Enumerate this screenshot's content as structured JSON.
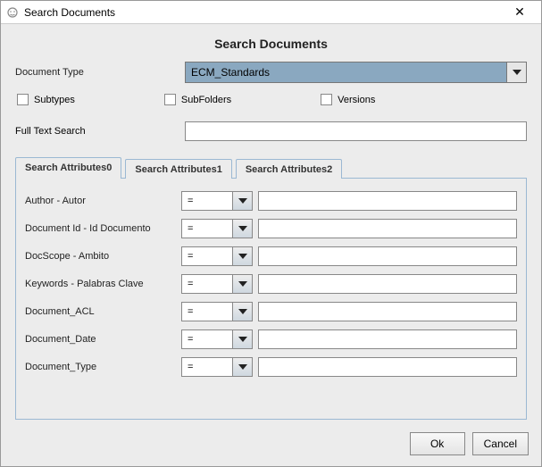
{
  "window": {
    "title": "Search Documents",
    "heading": "Search Documents"
  },
  "doctype": {
    "label": "Document Type",
    "value": "ECM_Standards"
  },
  "checks": {
    "subtypes": "Subtypes",
    "subfolders": "SubFolders",
    "versions": "Versions"
  },
  "fulltext": {
    "label": "Full Text Search",
    "value": ""
  },
  "tabs": {
    "t0": "Search Attributes0",
    "t1": "Search Attributes1",
    "t2": "Search Attributes2"
  },
  "attrs": [
    {
      "label": "Author - Autor",
      "op": "="
    },
    {
      "label": "Document Id - Id Documento",
      "op": "="
    },
    {
      "label": "DocScope - Ambito",
      "op": "="
    },
    {
      "label": "Keywords - Palabras Clave",
      "op": "="
    },
    {
      "label": "Document_ACL",
      "op": "="
    },
    {
      "label": "Document_Date",
      "op": "="
    },
    {
      "label": "Document_Type",
      "op": "="
    }
  ],
  "buttons": {
    "ok": "Ok",
    "cancel": "Cancel"
  }
}
